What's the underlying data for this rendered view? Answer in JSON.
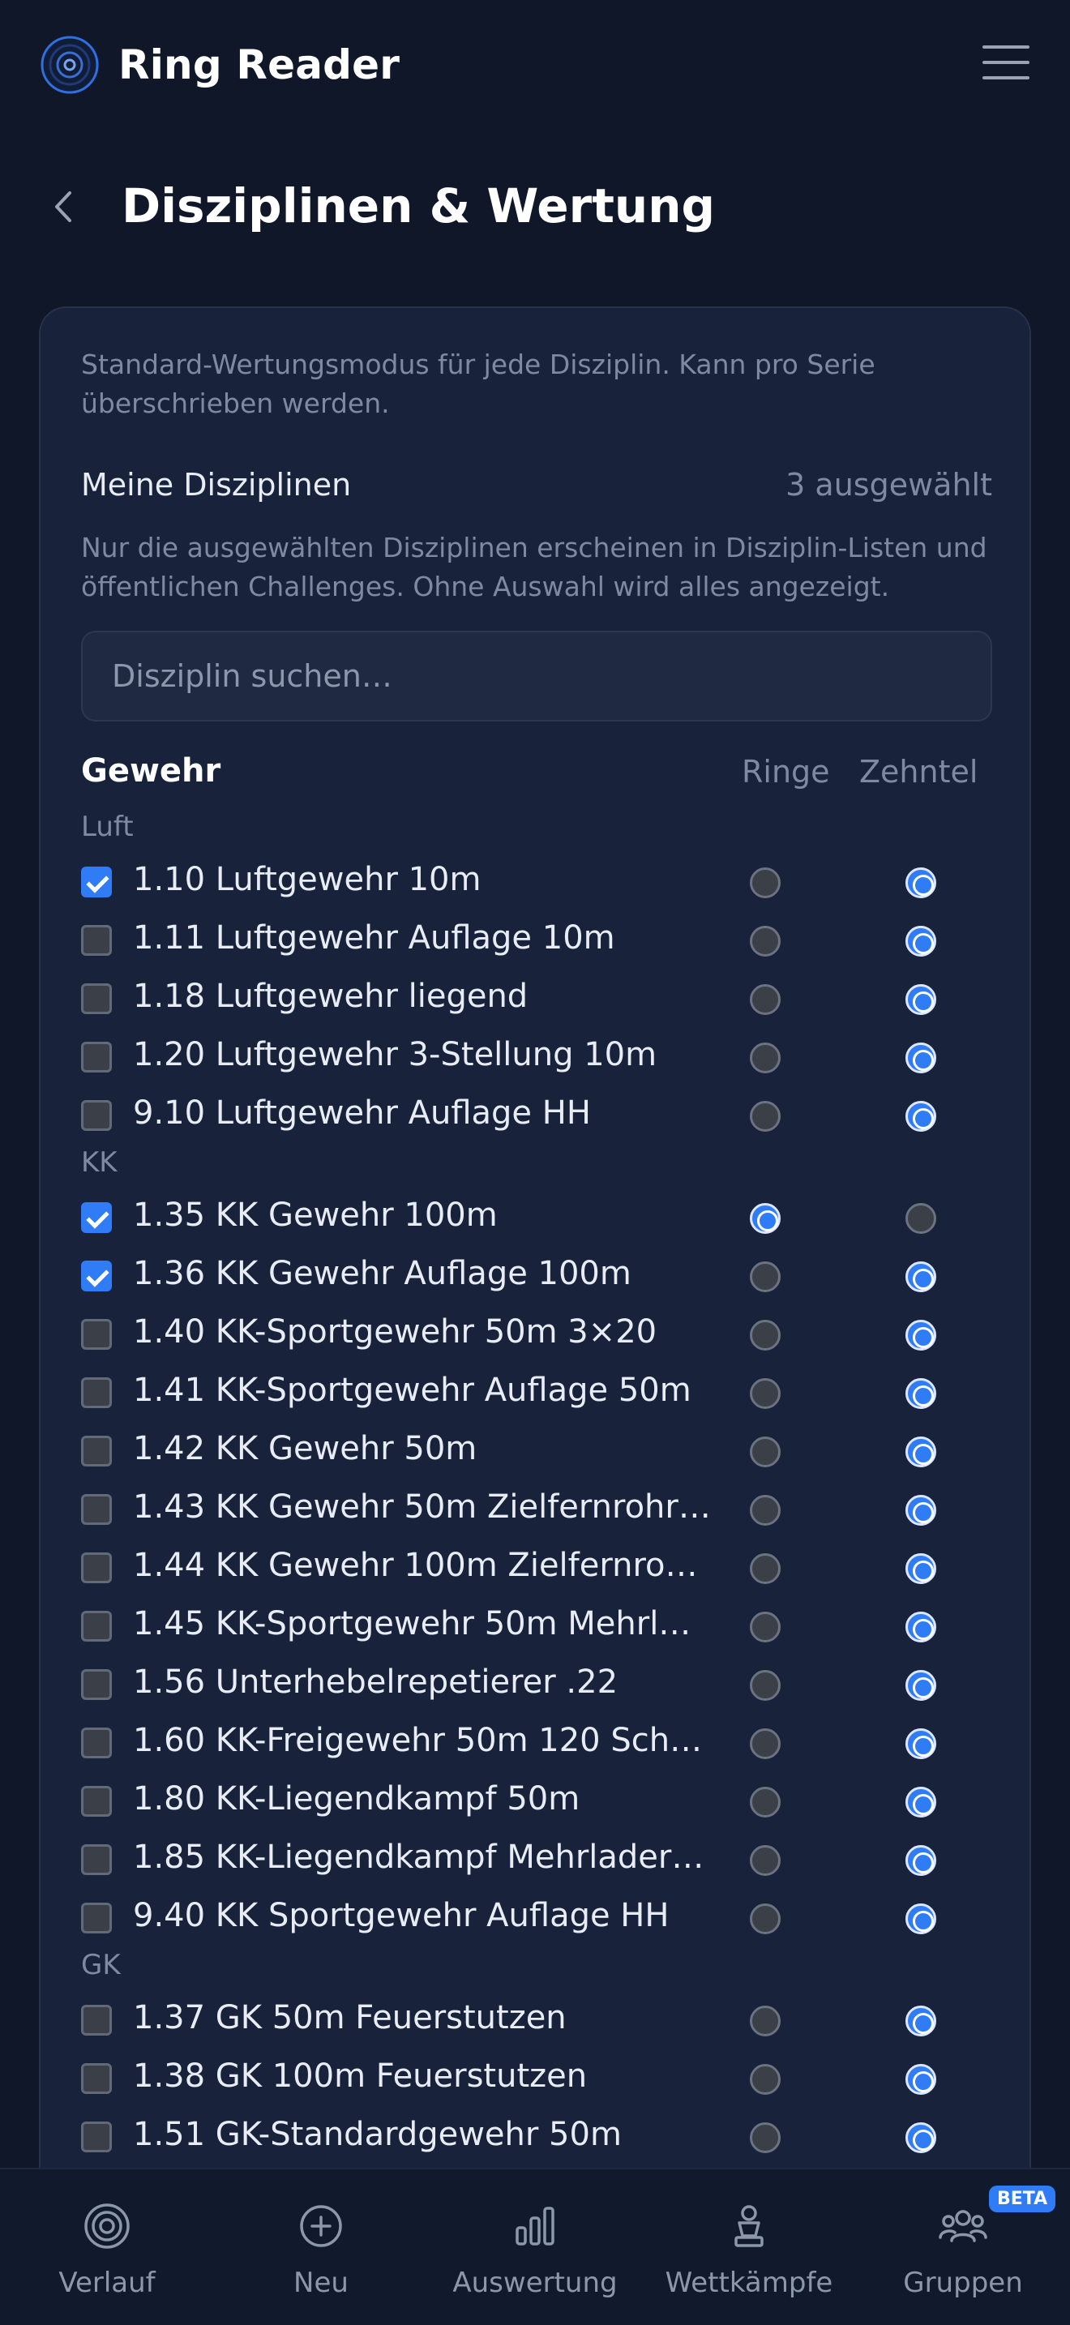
{
  "app": {
    "title": "Ring Reader"
  },
  "page": {
    "title": "Disziplinen & Wertung"
  },
  "card": {
    "intro": "Standard-Wertungsmodus für jede Disziplin. Kann pro Serie überschrieben werden.",
    "mine_label": "Meine Disziplinen",
    "mine_count": "3 ausgewählt",
    "note": "Nur die ausgewählten Disziplinen erscheinen in Disziplin-Listen und öffentlichen Challenges. Ohne Auswahl wird alles angezeigt.",
    "search_placeholder": "Disziplin suchen…"
  },
  "section": {
    "title": "Gewehr",
    "col_ringe": "Ringe",
    "col_zehntel": "Zehntel"
  },
  "groups": [
    {
      "label": "Luft",
      "items": [
        {
          "label": "1.10 Luftgewehr 10m",
          "checked": true,
          "mode": "zehntel"
        },
        {
          "label": "1.11 Luftgewehr Auflage 10m",
          "checked": false,
          "mode": "zehntel"
        },
        {
          "label": "1.18 Luftgewehr liegend",
          "checked": false,
          "mode": "zehntel"
        },
        {
          "label": "1.20 Luftgewehr 3-Stellung 10m",
          "checked": false,
          "mode": "zehntel"
        },
        {
          "label": "9.10 Luftgewehr Auflage HH",
          "checked": false,
          "mode": "zehntel"
        }
      ]
    },
    {
      "label": "KK",
      "items": [
        {
          "label": "1.35 KK Gewehr 100m",
          "checked": true,
          "mode": "ringe"
        },
        {
          "label": "1.36 KK Gewehr Auflage 100m",
          "checked": true,
          "mode": "zehntel"
        },
        {
          "label": "1.40 KK-Sportgewehr 50m 3×20",
          "checked": false,
          "mode": "zehntel"
        },
        {
          "label": "1.41 KK-Sportgewehr Auflage 50m",
          "checked": false,
          "mode": "zehntel"
        },
        {
          "label": "1.42 KK Gewehr 50m",
          "checked": false,
          "mode": "zehntel"
        },
        {
          "label": "1.43 KK Gewehr 50m Zielfernrohr…",
          "checked": false,
          "mode": "zehntel"
        },
        {
          "label": "1.44 KK Gewehr 100m Zielfernro…",
          "checked": false,
          "mode": "zehntel"
        },
        {
          "label": "1.45 KK-Sportgewehr 50m Mehrl…",
          "checked": false,
          "mode": "zehntel"
        },
        {
          "label": "1.56 Unterhebelrepetierer .22",
          "checked": false,
          "mode": "zehntel"
        },
        {
          "label": "1.60 KK-Freigewehr 50m 120 Sch…",
          "checked": false,
          "mode": "zehntel"
        },
        {
          "label": "1.80 KK-Liegendkampf 50m",
          "checked": false,
          "mode": "zehntel"
        },
        {
          "label": "1.85 KK-Liegendkampf Mehrlader…",
          "checked": false,
          "mode": "zehntel"
        },
        {
          "label": "9.40 KK Sportgewehr Auflage HH",
          "checked": false,
          "mode": "zehntel"
        }
      ]
    },
    {
      "label": "GK",
      "items": [
        {
          "label": "1.37 GK 50m Feuerstutzen",
          "checked": false,
          "mode": "zehntel"
        },
        {
          "label": "1.38 GK 100m Feuerstutzen",
          "checked": false,
          "mode": "zehntel"
        },
        {
          "label": "1.51 GK-Standardgewehr 50m",
          "checked": false,
          "mode": "zehntel"
        }
      ]
    }
  ],
  "nav": [
    {
      "label": "Verlauf",
      "icon": "target-icon"
    },
    {
      "label": "Neu",
      "icon": "plus-circle-icon"
    },
    {
      "label": "Auswertung",
      "icon": "bar-chart-icon"
    },
    {
      "label": "Wettkämpfe",
      "icon": "trophy-icon"
    },
    {
      "label": "Gruppen",
      "icon": "group-icon",
      "badge": "BETA"
    }
  ],
  "colors": {
    "accent": "#2f7cf6",
    "background": "#0f1729",
    "card": "#18223a"
  }
}
